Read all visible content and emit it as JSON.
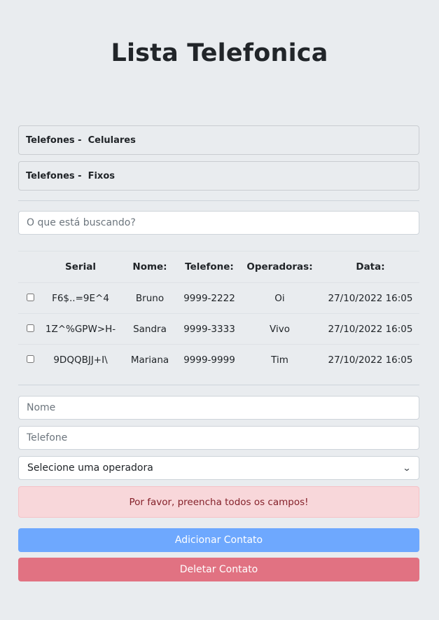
{
  "page": {
    "title": "Lista Telefonica"
  },
  "accordion": [
    {
      "label": "Telefones -  Celulares"
    },
    {
      "label": "Telefones -  Fixos"
    }
  ],
  "search": {
    "placeholder": "O que está buscando?"
  },
  "table": {
    "headers": [
      "",
      "Serial",
      "Nome:",
      "Telefone:",
      "Operadoras:",
      "Data:"
    ],
    "rows": [
      {
        "serial": "F6$..=9E^4",
        "nome": "Bruno",
        "telefone": "9999-2222",
        "operadora": "Oi",
        "data": "27/10/2022 16:05"
      },
      {
        "serial": "1Z^%GPW>H-",
        "nome": "Sandra",
        "telefone": "9999-3333",
        "operadora": "Vivo",
        "data": "27/10/2022 16:05"
      },
      {
        "serial": "9DQQBJJ+I\\",
        "nome": "Mariana",
        "telefone": "9999-9999",
        "operadora": "Tim",
        "data": "27/10/2022 16:05"
      }
    ]
  },
  "form": {
    "nome_placeholder": "Nome",
    "telefone_placeholder": "Telefone",
    "operadora_selected": "Selecione uma operadora"
  },
  "alert": {
    "message": "Por favor, preencha todos os campos!"
  },
  "buttons": {
    "add_label": "Adicionar Contato",
    "delete_label": "Deletar Contato"
  },
  "colors": {
    "background": "#e9ecef",
    "primary_button": "#6ea8fe",
    "danger_button": "#e17282",
    "alert_background": "#f8d7da",
    "alert_text": "#842029"
  },
  "icons": {
    "select_arrow": "chevron-down-icon"
  }
}
